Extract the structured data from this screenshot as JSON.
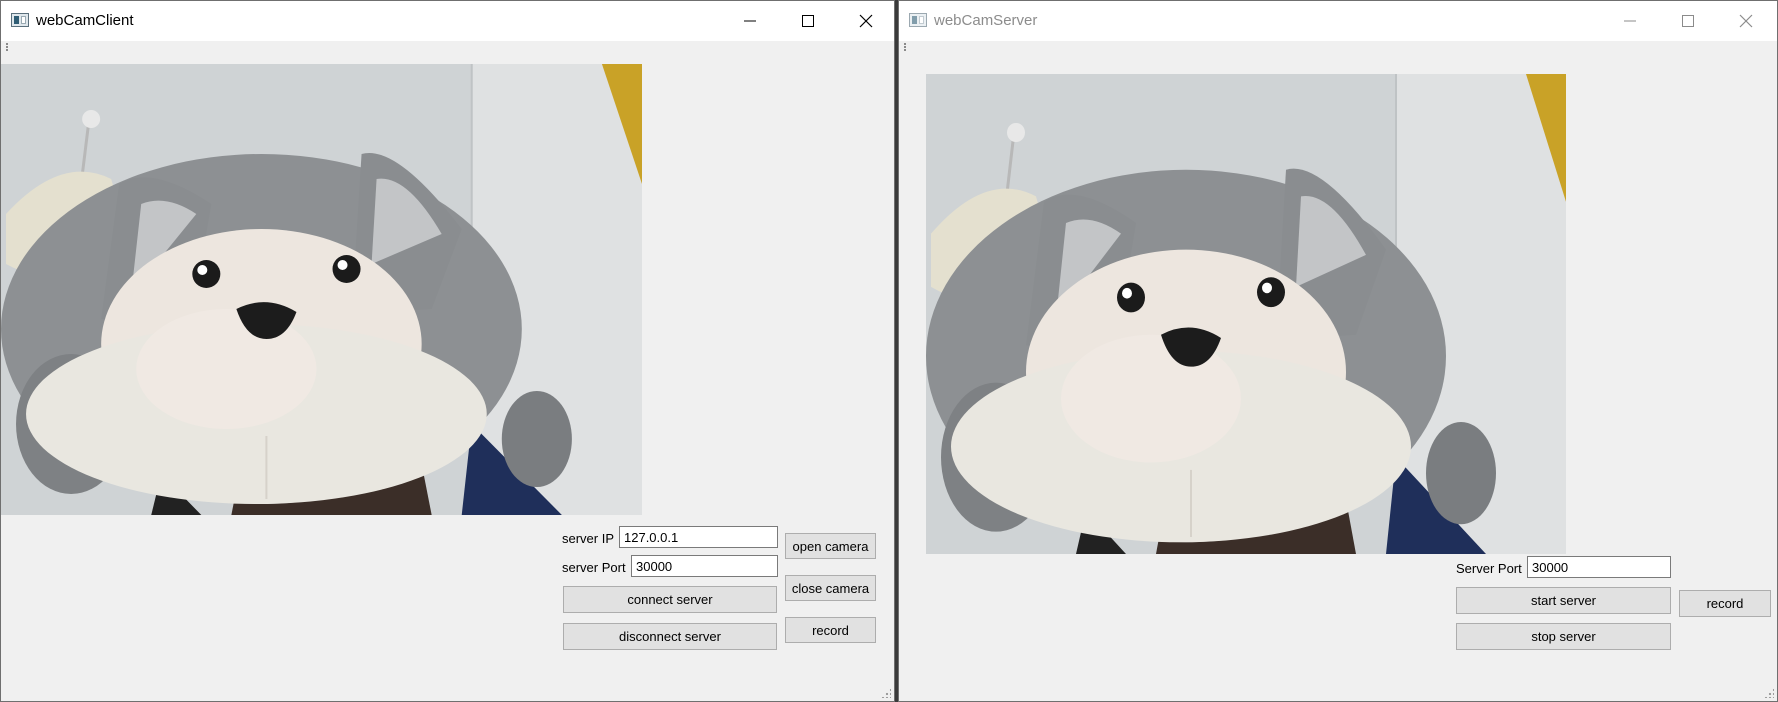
{
  "client": {
    "title": "webCamClient",
    "server_ip_label": "server IP",
    "server_ip_value": "127.0.0.1",
    "server_port_label": "server Port",
    "server_port_value": "30000",
    "buttons": {
      "connect": "connect server",
      "disconnect": "disconnect server",
      "open_camera": "open camera",
      "close_camera": "close camera",
      "record": "record"
    }
  },
  "server": {
    "title": "webCamServer",
    "server_port_label": "Server Port",
    "server_port_value": "30000",
    "buttons": {
      "start": "start server",
      "stop": "stop server",
      "record": "record"
    }
  },
  "icons": {
    "app": "app-window-icon",
    "minimize": "minimize-icon",
    "maximize": "maximize-icon",
    "close": "close-icon"
  },
  "colors": {
    "window_bg": "#f0f0f0",
    "titlebar_bg": "#ffffff",
    "button_bg": "#e1e1e1",
    "button_border": "#adadad"
  }
}
